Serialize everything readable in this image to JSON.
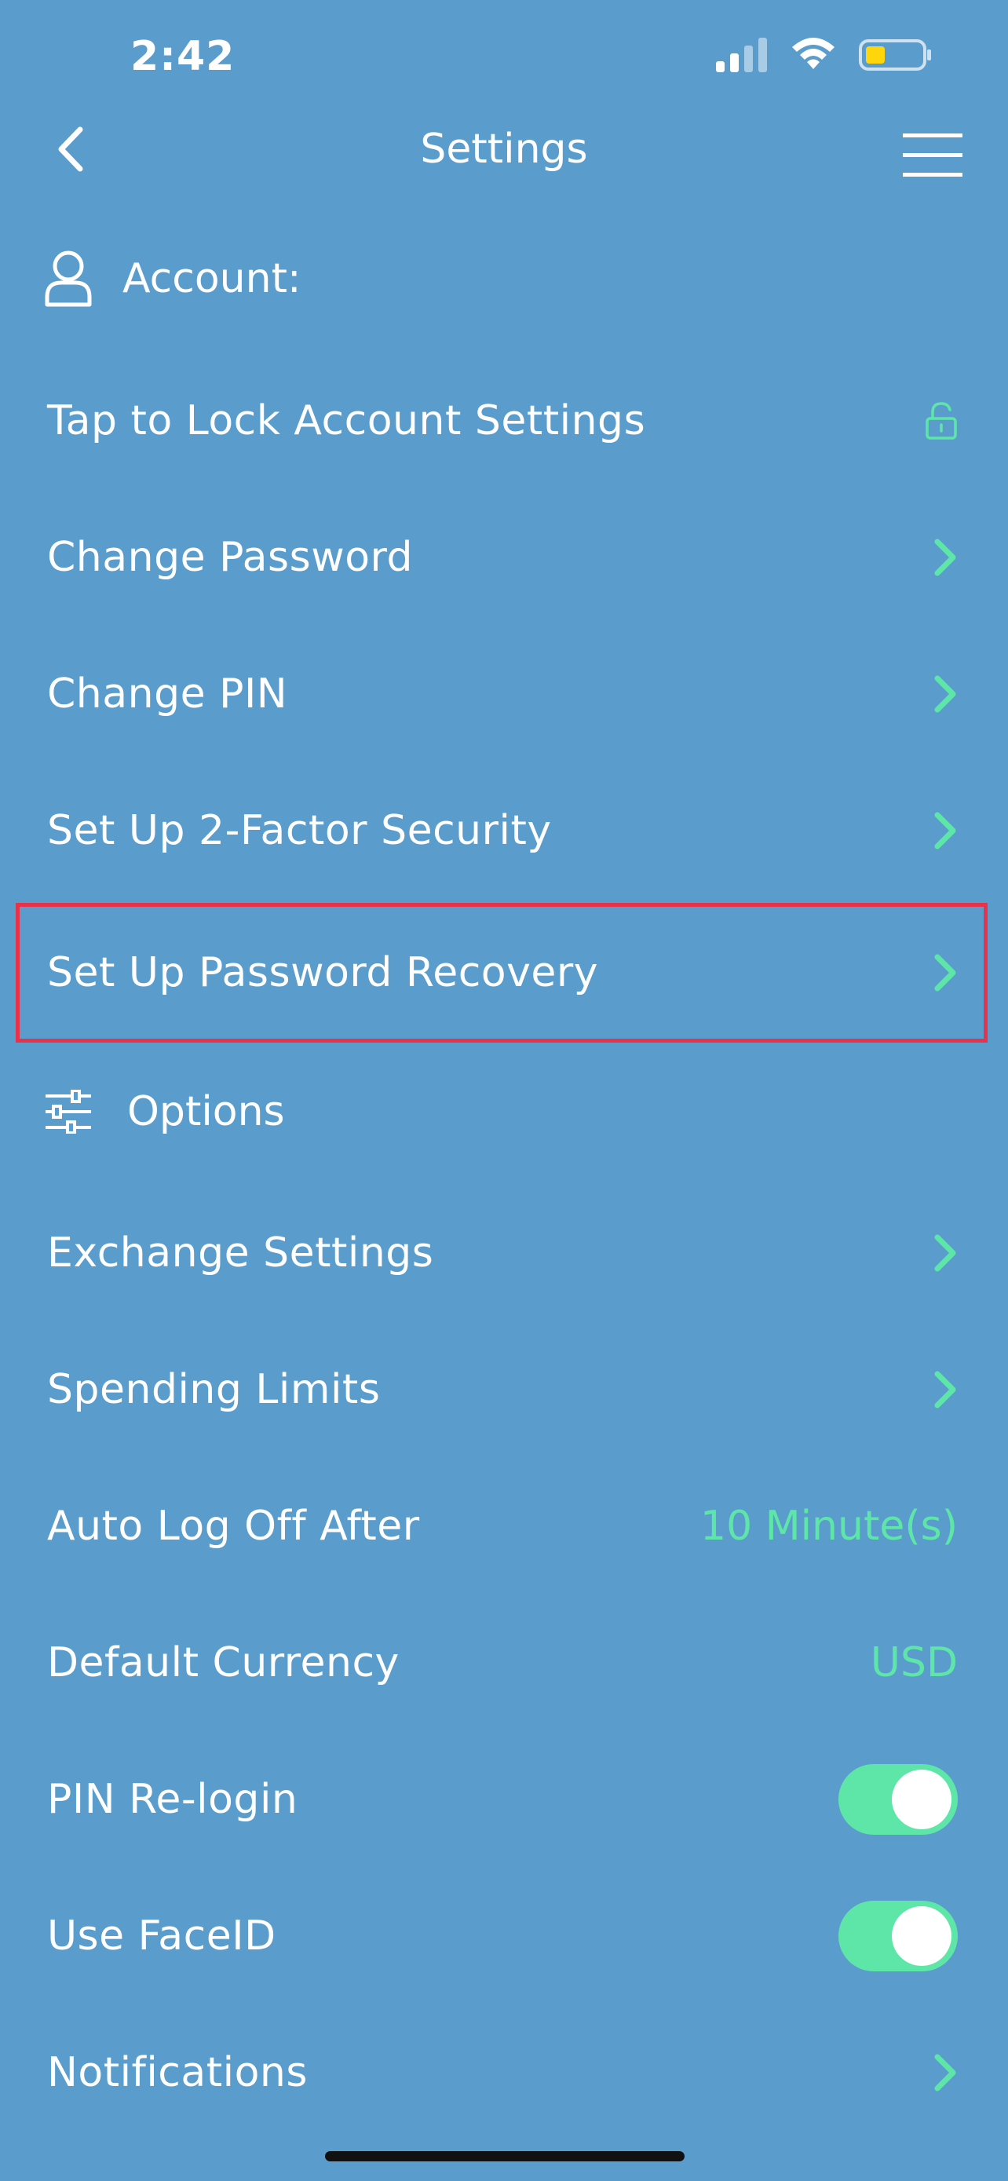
{
  "status_bar": {
    "time": "2:42"
  },
  "nav": {
    "title": "Settings"
  },
  "account_section": {
    "header": "Account:",
    "items": [
      {
        "label": "Tap to Lock Account Settings",
        "icon": "unlock-icon"
      },
      {
        "label": "Change Password",
        "icon": "chevron-right-icon"
      },
      {
        "label": "Change PIN",
        "icon": "chevron-right-icon"
      },
      {
        "label": "Set Up 2-Factor Security",
        "icon": "chevron-right-icon"
      },
      {
        "label": "Set Up Password Recovery",
        "icon": "chevron-right-icon",
        "highlighted": true
      }
    ]
  },
  "options_section": {
    "header": "Options",
    "items": [
      {
        "label": "Exchange Settings",
        "icon": "chevron-right-icon"
      },
      {
        "label": "Spending Limits",
        "icon": "chevron-right-icon"
      },
      {
        "label": "Auto Log Off After",
        "value": "10 Minute(s)"
      },
      {
        "label": "Default Currency",
        "value": "USD"
      },
      {
        "label": "PIN Re-login",
        "toggle": true
      },
      {
        "label": "Use FaceID",
        "toggle": true
      },
      {
        "label": "Notifications",
        "icon": "chevron-right-icon"
      }
    ]
  },
  "colors": {
    "background": "#5a9dcc",
    "accent": "#5ee6a8",
    "highlight": "#e8324a"
  }
}
